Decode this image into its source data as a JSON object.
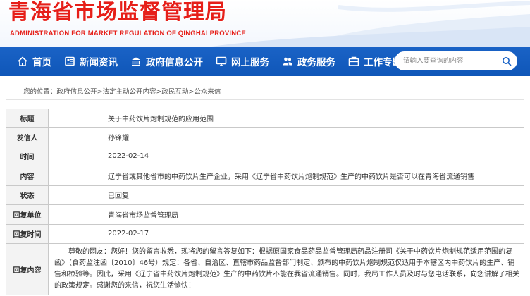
{
  "header": {
    "title": "青海省市场监督管理局",
    "subtitle": "ADMINISTRATION FOR MARKET REGULATION OF QINGHAI PROVINCE"
  },
  "nav": {
    "items": [
      {
        "label": "首页",
        "icon": "home-icon"
      },
      {
        "label": "新闻资讯",
        "icon": "newspaper-icon"
      },
      {
        "label": "政府信息公开",
        "icon": "building-icon"
      },
      {
        "label": "网上服务",
        "icon": "monitor-icon"
      },
      {
        "label": "政务服务",
        "icon": "users-icon"
      },
      {
        "label": "工作专题",
        "icon": "briefcase-icon"
      }
    ],
    "search_placeholder": "请输入要查询的内容"
  },
  "breadcrumb": {
    "prefix": "您的位置：",
    "path": "政府信息公开>法定主动公开内容>政民互动>公众来信"
  },
  "record": {
    "title_label": "标题",
    "title_value": "关于中药饮片炮制规范的应用范围",
    "sender_label": "发信人",
    "sender_value": "孙锋耀",
    "time_label": "时间",
    "time_value": "2022-02-14",
    "content_label": "内容",
    "content_value": "辽宁省或其他省市的中药饮片生产企业，采用《辽宁省中药饮片炮制规范》生产的中药饮片是否可以在青海省流通销售",
    "status_label": "状态",
    "status_value": "已回复",
    "reply_unit_label": "回复单位",
    "reply_unit_value": "青海省市场监督管理局",
    "reply_time_label": "回复时间",
    "reply_time_value": "2022-02-17",
    "reply_content_label": "回复内容",
    "reply_content_value": "尊敬的网友：您好！您的留言收悉，现将您的留言答复如下：根据原国家食品药品监督管理局药品注册司《关于中药饮片炮制规范适用范围的复函》（食药监注函〔2010〕46号）规定：各省、自治区、直辖市药品监督部门制定、颁布的中药饮片炮制规范仅适用于本辖区内中药饮片的生产、销售和检验等。因此，采用《辽宁省中药饮片炮制规范》生产的中药饮片不能在我省流通销售。同时，我局工作人员及时与您电话联系，向您讲解了相关的政策规定。感谢您的来信，祝您生活愉快！"
  },
  "colors": {
    "title_red": "#e61f19",
    "nav_blue": "#1a63c6",
    "label_bg": "#f3f3f3",
    "border": "#c9c9c9"
  }
}
